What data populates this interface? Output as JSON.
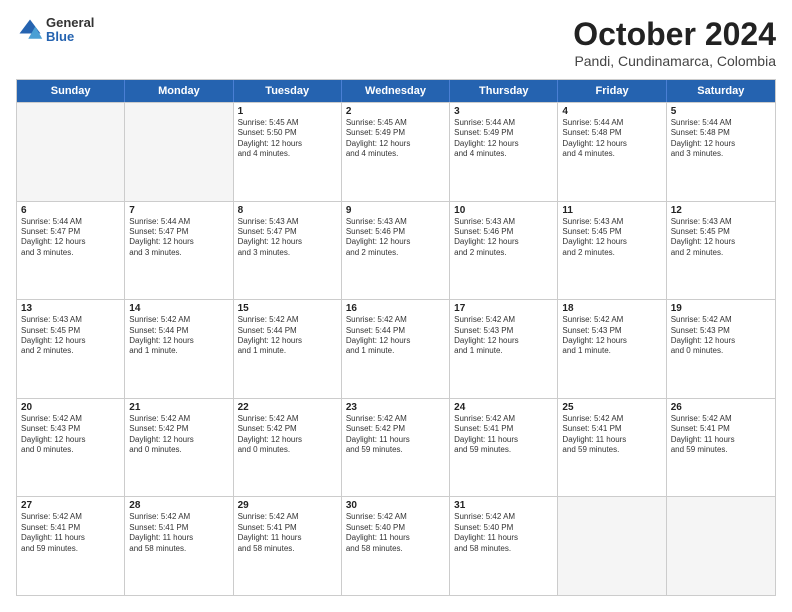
{
  "logo": {
    "general": "General",
    "blue": "Blue"
  },
  "header": {
    "title": "October 2024",
    "subtitle": "Pandi, Cundinamarca, Colombia"
  },
  "weekdays": [
    "Sunday",
    "Monday",
    "Tuesday",
    "Wednesday",
    "Thursday",
    "Friday",
    "Saturday"
  ],
  "weeks": [
    [
      {
        "day": "",
        "info": ""
      },
      {
        "day": "",
        "info": ""
      },
      {
        "day": "1",
        "info": "Sunrise: 5:45 AM\nSunset: 5:50 PM\nDaylight: 12 hours\nand 4 minutes."
      },
      {
        "day": "2",
        "info": "Sunrise: 5:45 AM\nSunset: 5:49 PM\nDaylight: 12 hours\nand 4 minutes."
      },
      {
        "day": "3",
        "info": "Sunrise: 5:44 AM\nSunset: 5:49 PM\nDaylight: 12 hours\nand 4 minutes."
      },
      {
        "day": "4",
        "info": "Sunrise: 5:44 AM\nSunset: 5:48 PM\nDaylight: 12 hours\nand 4 minutes."
      },
      {
        "day": "5",
        "info": "Sunrise: 5:44 AM\nSunset: 5:48 PM\nDaylight: 12 hours\nand 3 minutes."
      }
    ],
    [
      {
        "day": "6",
        "info": "Sunrise: 5:44 AM\nSunset: 5:47 PM\nDaylight: 12 hours\nand 3 minutes."
      },
      {
        "day": "7",
        "info": "Sunrise: 5:44 AM\nSunset: 5:47 PM\nDaylight: 12 hours\nand 3 minutes."
      },
      {
        "day": "8",
        "info": "Sunrise: 5:43 AM\nSunset: 5:47 PM\nDaylight: 12 hours\nand 3 minutes."
      },
      {
        "day": "9",
        "info": "Sunrise: 5:43 AM\nSunset: 5:46 PM\nDaylight: 12 hours\nand 2 minutes."
      },
      {
        "day": "10",
        "info": "Sunrise: 5:43 AM\nSunset: 5:46 PM\nDaylight: 12 hours\nand 2 minutes."
      },
      {
        "day": "11",
        "info": "Sunrise: 5:43 AM\nSunset: 5:45 PM\nDaylight: 12 hours\nand 2 minutes."
      },
      {
        "day": "12",
        "info": "Sunrise: 5:43 AM\nSunset: 5:45 PM\nDaylight: 12 hours\nand 2 minutes."
      }
    ],
    [
      {
        "day": "13",
        "info": "Sunrise: 5:43 AM\nSunset: 5:45 PM\nDaylight: 12 hours\nand 2 minutes."
      },
      {
        "day": "14",
        "info": "Sunrise: 5:42 AM\nSunset: 5:44 PM\nDaylight: 12 hours\nand 1 minute."
      },
      {
        "day": "15",
        "info": "Sunrise: 5:42 AM\nSunset: 5:44 PM\nDaylight: 12 hours\nand 1 minute."
      },
      {
        "day": "16",
        "info": "Sunrise: 5:42 AM\nSunset: 5:44 PM\nDaylight: 12 hours\nand 1 minute."
      },
      {
        "day": "17",
        "info": "Sunrise: 5:42 AM\nSunset: 5:43 PM\nDaylight: 12 hours\nand 1 minute."
      },
      {
        "day": "18",
        "info": "Sunrise: 5:42 AM\nSunset: 5:43 PM\nDaylight: 12 hours\nand 1 minute."
      },
      {
        "day": "19",
        "info": "Sunrise: 5:42 AM\nSunset: 5:43 PM\nDaylight: 12 hours\nand 0 minutes."
      }
    ],
    [
      {
        "day": "20",
        "info": "Sunrise: 5:42 AM\nSunset: 5:43 PM\nDaylight: 12 hours\nand 0 minutes."
      },
      {
        "day": "21",
        "info": "Sunrise: 5:42 AM\nSunset: 5:42 PM\nDaylight: 12 hours\nand 0 minutes."
      },
      {
        "day": "22",
        "info": "Sunrise: 5:42 AM\nSunset: 5:42 PM\nDaylight: 12 hours\nand 0 minutes."
      },
      {
        "day": "23",
        "info": "Sunrise: 5:42 AM\nSunset: 5:42 PM\nDaylight: 11 hours\nand 59 minutes."
      },
      {
        "day": "24",
        "info": "Sunrise: 5:42 AM\nSunset: 5:41 PM\nDaylight: 11 hours\nand 59 minutes."
      },
      {
        "day": "25",
        "info": "Sunrise: 5:42 AM\nSunset: 5:41 PM\nDaylight: 11 hours\nand 59 minutes."
      },
      {
        "day": "26",
        "info": "Sunrise: 5:42 AM\nSunset: 5:41 PM\nDaylight: 11 hours\nand 59 minutes."
      }
    ],
    [
      {
        "day": "27",
        "info": "Sunrise: 5:42 AM\nSunset: 5:41 PM\nDaylight: 11 hours\nand 59 minutes."
      },
      {
        "day": "28",
        "info": "Sunrise: 5:42 AM\nSunset: 5:41 PM\nDaylight: 11 hours\nand 58 minutes."
      },
      {
        "day": "29",
        "info": "Sunrise: 5:42 AM\nSunset: 5:41 PM\nDaylight: 11 hours\nand 58 minutes."
      },
      {
        "day": "30",
        "info": "Sunrise: 5:42 AM\nSunset: 5:40 PM\nDaylight: 11 hours\nand 58 minutes."
      },
      {
        "day": "31",
        "info": "Sunrise: 5:42 AM\nSunset: 5:40 PM\nDaylight: 11 hours\nand 58 minutes."
      },
      {
        "day": "",
        "info": ""
      },
      {
        "day": "",
        "info": ""
      }
    ]
  ]
}
